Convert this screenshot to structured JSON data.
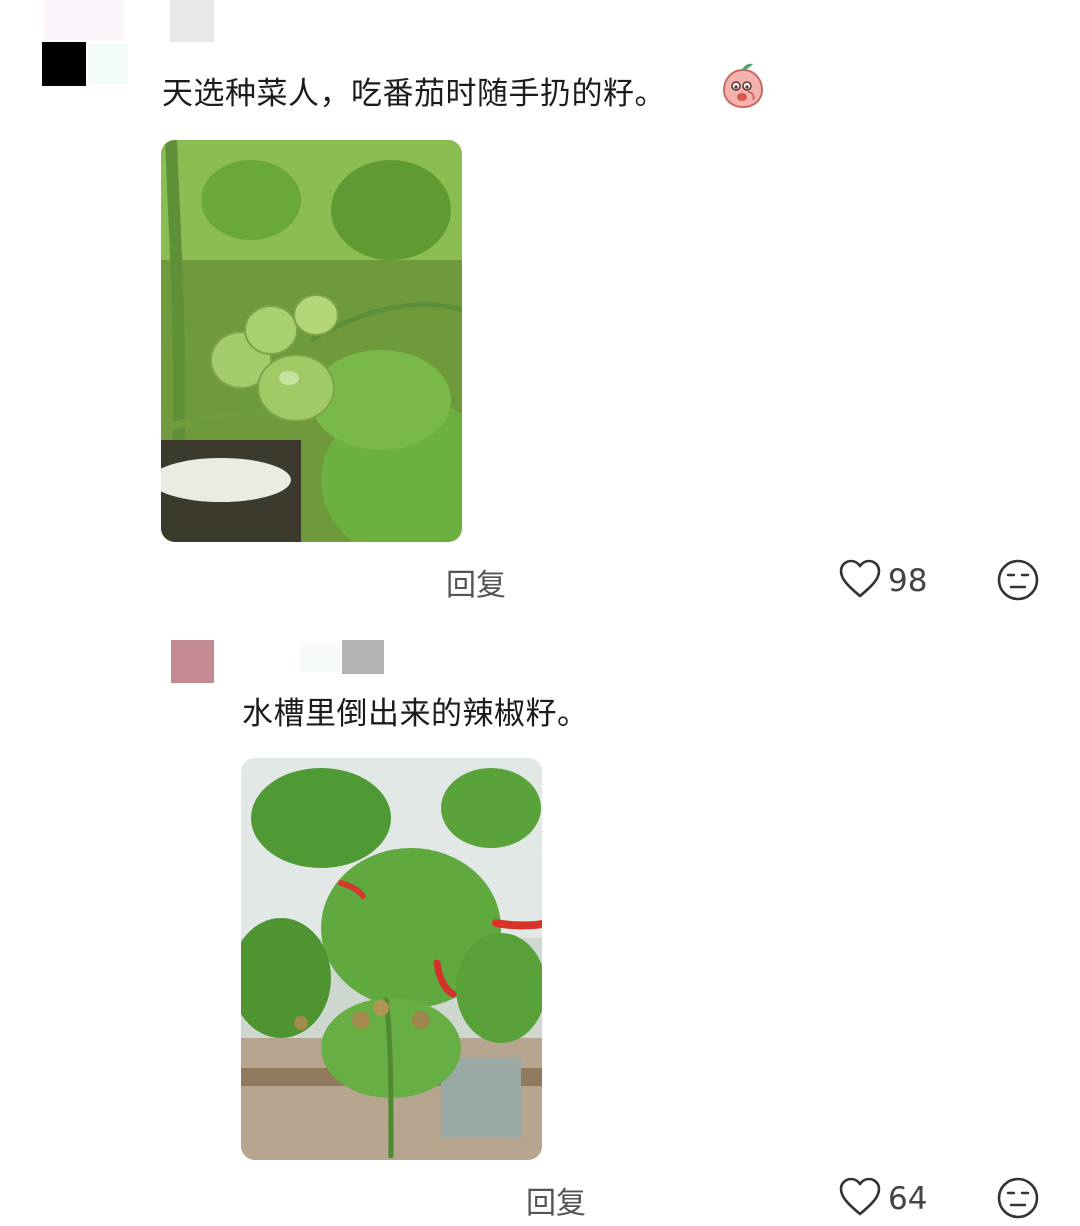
{
  "comments": [
    {
      "text": "天选种菜人，吃番茄时随手扔的籽。",
      "emoji_icon": "blushing-peach-emoji",
      "photo_description_icon": "tomato-plant-photo",
      "reply_label": "回复",
      "like_count": "98"
    },
    {
      "text": "水槽里倒出来的辣椒籽。",
      "photo_description_icon": "chili-plant-photo",
      "reply_label": "回复",
      "like_count": "64"
    }
  ],
  "colors": {
    "text": "#1c1c1c",
    "muted": "#555555",
    "avatar2": "#c38a94"
  }
}
